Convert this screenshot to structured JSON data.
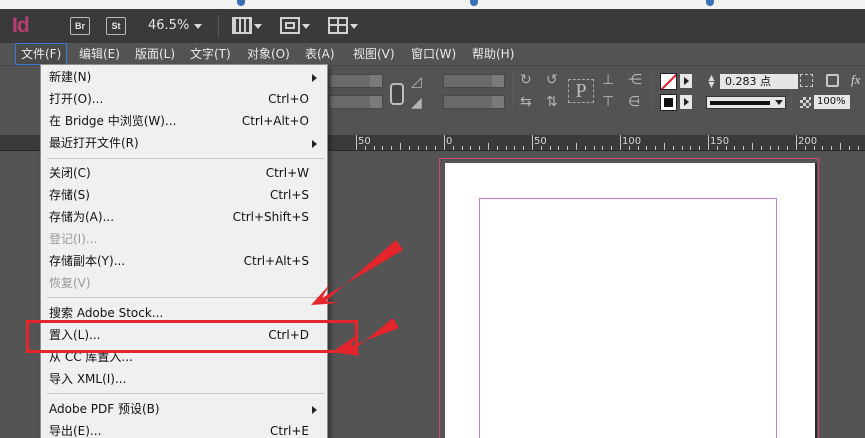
{
  "app": {
    "logo": "Id"
  },
  "appbar": {
    "br_label": "Br",
    "st_label": "St",
    "zoom": "46.5%"
  },
  "menubar": {
    "items": [
      {
        "label": "文件(F)",
        "active": true
      },
      {
        "label": "编辑(E)"
      },
      {
        "label": "版面(L)"
      },
      {
        "label": "文字(T)"
      },
      {
        "label": "对象(O)"
      },
      {
        "label": "表(A)"
      },
      {
        "label": "视图(V)"
      },
      {
        "label": "窗口(W)"
      },
      {
        "label": "帮助(H)"
      }
    ]
  },
  "control": {
    "stroke_weight": "0.283 点",
    "zoom": "100%",
    "font_glyph": "P",
    "fx_label": "fx"
  },
  "ruler": {
    "labels": [
      "50",
      "0",
      "50",
      "100",
      "150",
      "200"
    ]
  },
  "file_menu": {
    "items": [
      {
        "label": "新建(N)",
        "submenu": true
      },
      {
        "label": "打开(O)...",
        "shortcut": "Ctrl+O"
      },
      {
        "label": "在 Bridge 中浏览(W)...",
        "shortcut": "Ctrl+Alt+O"
      },
      {
        "label": "最近打开文件(R)",
        "submenu": true
      },
      {
        "label": "关闭(C)",
        "shortcut": "Ctrl+W"
      },
      {
        "label": "存储(S)",
        "shortcut": "Ctrl+S"
      },
      {
        "label": "存储为(A)...",
        "shortcut": "Ctrl+Shift+S"
      },
      {
        "label": "登记(I)...",
        "disabled": true
      },
      {
        "label": "存储副本(Y)...",
        "shortcut": "Ctrl+Alt+S"
      },
      {
        "label": "恢复(V)",
        "disabled": true
      },
      {
        "label": "搜索 Adobe Stock..."
      },
      {
        "label": "置入(L)...",
        "shortcut": "Ctrl+D"
      },
      {
        "label": "从 CC 库置入..."
      },
      {
        "label": "导入 XML(I)..."
      },
      {
        "label": "Adobe PDF 预设(B)",
        "submenu": true
      },
      {
        "label": "导出(E)...",
        "shortcut": "Ctrl+E"
      }
    ]
  }
}
